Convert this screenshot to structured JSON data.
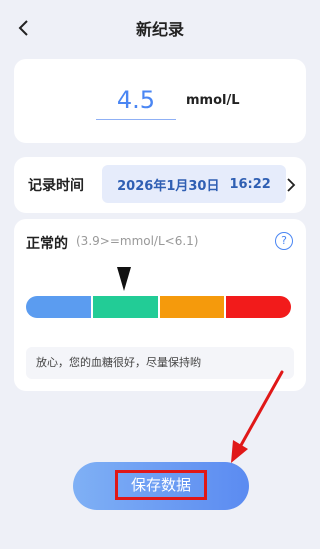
{
  "header": {
    "title": "新纪录",
    "back_icon": "chevron-left-icon"
  },
  "reading": {
    "value": "4.5",
    "unit": "mmol/L"
  },
  "record_time": {
    "label": "记录时间",
    "date": "2026年1月30日",
    "time": "16:22",
    "chevron_icon": "chevron-right-icon"
  },
  "status": {
    "title": "正常的",
    "range": "(3.9>=mmol/L<6.1)",
    "help_icon": "question-circle-icon",
    "help_glyph": "?",
    "level_index": 1,
    "scale_colors": [
      "#5b9cf0",
      "#22cc96",
      "#f59a0c",
      "#f21b1b"
    ],
    "advice": "放心，您的血糖很好，尽量保持哟"
  },
  "actions": {
    "save_label": "保存数据"
  },
  "annotation": {
    "color": "#e01818"
  }
}
